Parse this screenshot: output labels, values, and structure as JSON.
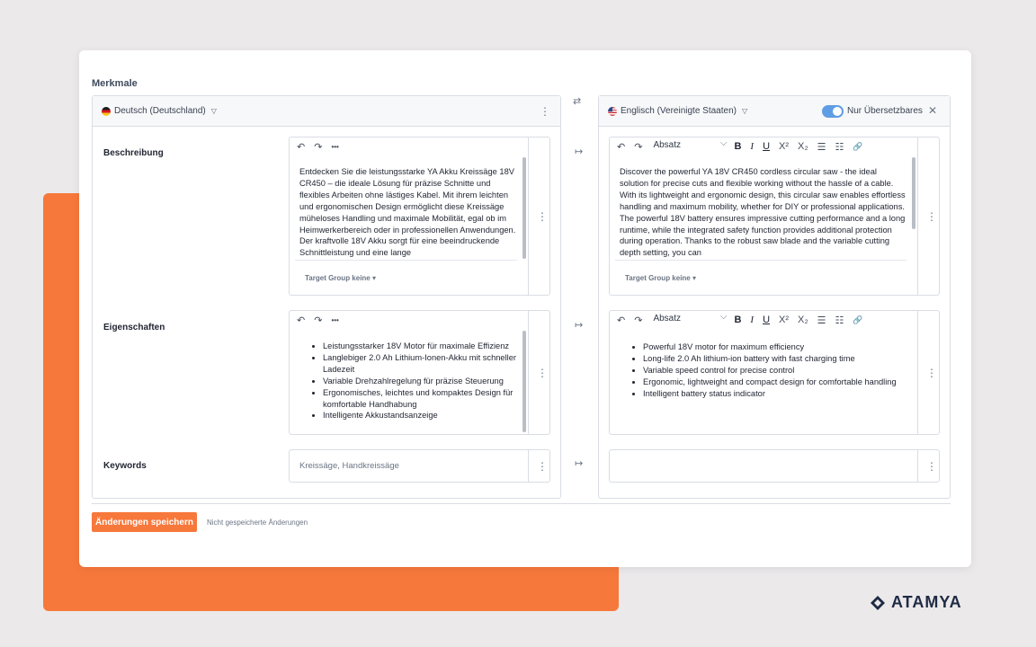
{
  "section_title": "Merkmale",
  "source": {
    "language": "Deutsch (Deutschland)",
    "fields": {
      "description": {
        "label": "Beschreibung",
        "text": "Entdecken Sie die leistungsstarke YA Akku Kreissäge 18V CR450 – die ideale Lösung für präzise Schnitte und flexibles Arbeiten ohne lästiges Kabel. Mit ihrem leichten und ergonomischen Design ermöglicht diese Kreissäge müheloses Handling und maximale Mobilität, egal ob im Heimwerkerbereich oder in professionellen Anwendungen. Der kraftvolle 18V Akku sorgt für eine beeindruckende Schnittleistung und eine lange",
        "target_group": "Target Group keine"
      },
      "properties": {
        "label": "Eigenschaften",
        "items": [
          "Leistungsstarker 18V Motor für maximale Effizienz",
          "Langlebiger 2.0 Ah Lithium-Ionen-Akku mit schneller Ladezeit",
          "Variable Drehzahlregelung für präzise Steuerung",
          "Ergonomisches, leichtes und kompaktes Design für komfortable Handhabung",
          "Intelligente Akkustandsanzeige"
        ]
      },
      "keywords": {
        "label": "Keywords",
        "value": "Kreissäge, Handkreissäge"
      }
    }
  },
  "target": {
    "language": "Englisch (Vereinigte Staaten)",
    "toggle_label": "Nur Übersetzbares",
    "toggle_on": true,
    "paragraph_style": "Absatz",
    "description": {
      "text": "Discover the powerful YA 18V CR450 cordless circular saw - the ideal solution for precise cuts and flexible working without the hassle of a cable. With its lightweight and ergonomic design, this circular saw enables effortless handling and maximum mobility, whether for DIY or professional applications. The powerful 18V battery ensures impressive cutting performance and a long runtime, while the integrated safety function provides additional protection during operation. Thanks to the robust saw blade and the variable cutting depth setting, you can",
      "target_group": "Target Group keine"
    },
    "properties": {
      "items": [
        "Powerful 18V motor for maximum efficiency",
        "Long-life 2.0 Ah lithium-ion battery with fast charging time",
        "Variable speed control for precise control",
        "Ergonomic, lightweight and compact design for comfortable handling",
        "Intelligent battery status indicator"
      ]
    },
    "keywords": {
      "value": ""
    }
  },
  "icons": {
    "undo": "↶",
    "redo": "↷",
    "more": "•••",
    "swap": "⇄",
    "transfer": "↦",
    "kebab": "⋮",
    "close": "✕",
    "bold": "B",
    "italic": "I",
    "underline": "U",
    "superscript": "X²",
    "subscript": "X₂",
    "bullet_list": "☰",
    "numbered_list": "☷",
    "link": "🔗"
  },
  "footer": {
    "save_label": "Änderungen speichern",
    "unsaved_text": "Nicht gespeicherte Änderungen"
  },
  "brand": {
    "logo_text": "ATAMYA"
  },
  "colors": {
    "accent": "#f7783b",
    "toggle": "#5f9de4",
    "brand": "#1f2a44"
  }
}
